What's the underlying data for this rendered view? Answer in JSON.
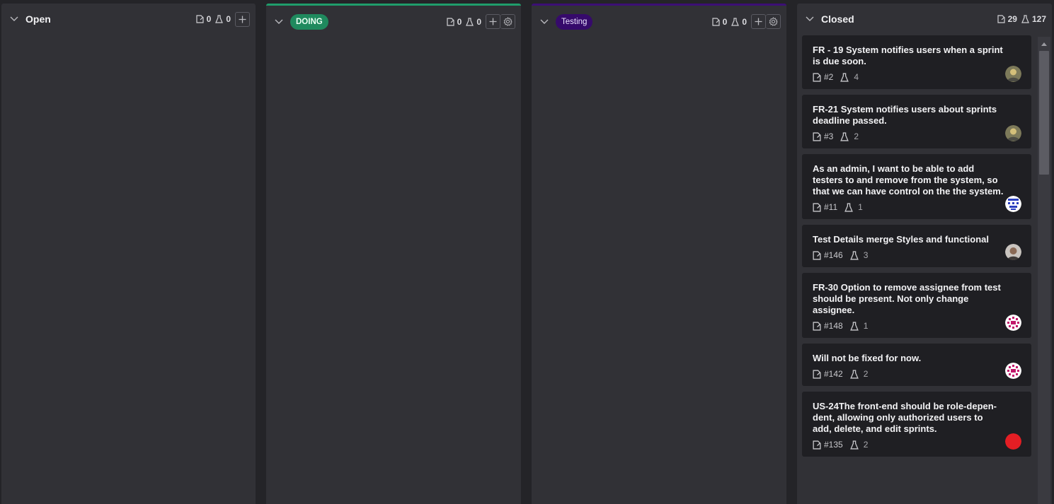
{
  "columns": {
    "open": {
      "title": "Open",
      "tasks": "0",
      "tests": "0"
    },
    "doing": {
      "title": "DOING",
      "tasks": "0",
      "tests": "0",
      "accent": "#1f9d6b"
    },
    "testing": {
      "title": "Testing",
      "tasks": "0",
      "tests": "0",
      "accent": "#3c0f75"
    },
    "closed": {
      "title": "Closed",
      "tasks": "29",
      "tests": "127"
    }
  },
  "closed_cards": [
    {
      "title": "FR - 19 System notifies users when a sprint is due soon.",
      "id": "#2",
      "count": "4",
      "avatar": "avatar-photo"
    },
    {
      "title": "FR-21 System notifies users about sprints deadline passed.",
      "id": "#3",
      "count": "2",
      "avatar": "avatar-photo"
    },
    {
      "title": "As an admin, I want to be able to add testers to and remove from the system, so that we can have control on the the system.",
      "id": "#11",
      "count": "1",
      "avatar": "avatar-identicon-blue"
    },
    {
      "title": "Test Details merge Styles and functional",
      "id": "#146",
      "count": "3",
      "avatar": "avatar-photo-person"
    },
    {
      "title": "FR-30 Option to remove assignee from test should be present. Not only change assignee.",
      "id": "#148",
      "count": "1",
      "avatar": "avatar-identicon-pink"
    },
    {
      "title": "Will not be fixed for now.",
      "id": "#142",
      "count": "2",
      "avatar": "avatar-identicon-pink"
    },
    {
      "title": "US-24The front-end should be role-depen-dent, allowing only authorized users to add, delete, and edit sprints.",
      "id": "#135",
      "count": "2",
      "avatar": "avatar-red"
    }
  ]
}
